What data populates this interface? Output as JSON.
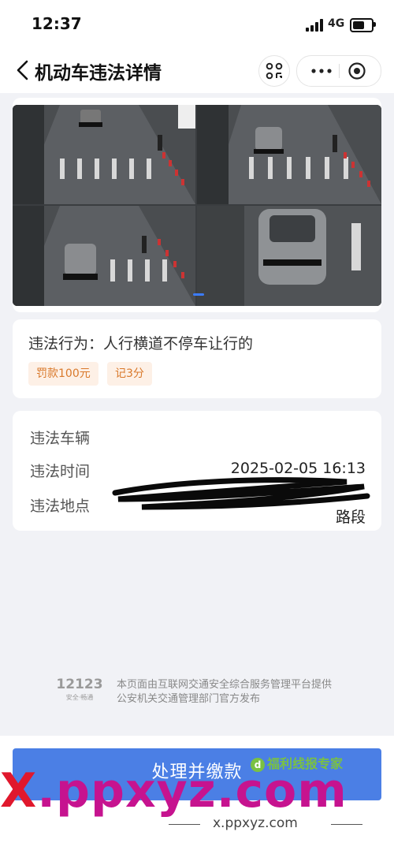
{
  "status_bar": {
    "time": "12:37",
    "network": "4G"
  },
  "header": {
    "title": "机动车违法详情"
  },
  "violation": {
    "behavior_label": "违法行为：",
    "behavior": "人行横道不停车让行的",
    "fine_tag": "罚款100元",
    "points_tag": "记3分"
  },
  "details": {
    "vehicle_label": "违法车辆",
    "time_label": "违法时间",
    "time_value": "2025-02-05 16:13",
    "location_label": "违法地点",
    "location_value_end": "路段"
  },
  "footer": {
    "logo_number": "12123",
    "logo_sub": "安全·畅通",
    "line1": "本页面由互联网交通安全综合服务管理平台提供",
    "line2": "公安机关交通管理部门官方发布"
  },
  "action": {
    "pay_button": "处理并缴款"
  },
  "watermarks": {
    "badge": "福利线报专家",
    "big": ".ppxyz.com",
    "big_prefix": "X",
    "small": "x.ppxyz.com"
  },
  "colors": {
    "accent": "#4b7fe5",
    "tag_bg": "#fdf0e6",
    "tag_text": "#d9792b"
  }
}
